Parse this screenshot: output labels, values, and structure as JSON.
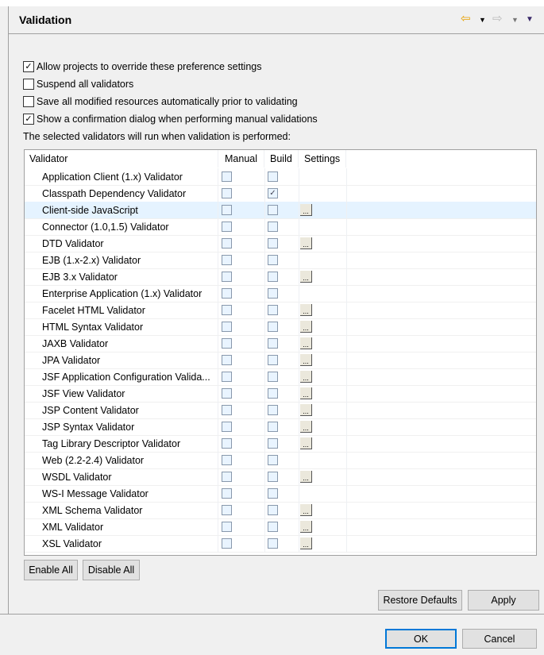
{
  "header": {
    "title": "Validation",
    "icons": [
      "back-arrow-icon",
      "back-menu-icon",
      "forward-arrow-icon",
      "forward-menu-icon",
      "view-menu-icon"
    ]
  },
  "options": [
    {
      "label": "Allow projects to override these preference settings",
      "checked": true
    },
    {
      "label": "Suspend all validators",
      "checked": false
    },
    {
      "label": "Save all modified resources automatically prior to validating",
      "checked": false
    },
    {
      "label": "Show a confirmation dialog when performing manual validations",
      "checked": true
    }
  ],
  "table_caption": "The selected validators will run when validation is performed:",
  "table": {
    "columns": [
      "Validator",
      "Manual",
      "Build",
      "Settings"
    ],
    "selected_row": "Client-side JavaScript",
    "rows": [
      {
        "name": "Application Client (1.x) Validator",
        "manual": false,
        "build": false,
        "settings": false
      },
      {
        "name": "Classpath Dependency Validator",
        "manual": false,
        "build": true,
        "settings": false
      },
      {
        "name": "Client-side JavaScript",
        "manual": false,
        "build": false,
        "settings": true
      },
      {
        "name": "Connector (1.0,1.5) Validator",
        "manual": false,
        "build": false,
        "settings": false
      },
      {
        "name": "DTD Validator",
        "manual": false,
        "build": false,
        "settings": true
      },
      {
        "name": "EJB (1.x-2.x) Validator",
        "manual": false,
        "build": false,
        "settings": false
      },
      {
        "name": "EJB 3.x Validator",
        "manual": false,
        "build": false,
        "settings": true
      },
      {
        "name": "Enterprise Application (1.x) Validator",
        "manual": false,
        "build": false,
        "settings": false
      },
      {
        "name": "Facelet HTML Validator",
        "manual": false,
        "build": false,
        "settings": true
      },
      {
        "name": "HTML Syntax Validator",
        "manual": false,
        "build": false,
        "settings": true
      },
      {
        "name": "JAXB Validator",
        "manual": false,
        "build": false,
        "settings": true
      },
      {
        "name": "JPA Validator",
        "manual": false,
        "build": false,
        "settings": true
      },
      {
        "name": "JSF Application Configuration Valida...",
        "manual": false,
        "build": false,
        "settings": true
      },
      {
        "name": "JSF View Validator",
        "manual": false,
        "build": false,
        "settings": true
      },
      {
        "name": "JSP Content Validator",
        "manual": false,
        "build": false,
        "settings": true
      },
      {
        "name": "JSP Syntax Validator",
        "manual": false,
        "build": false,
        "settings": true
      },
      {
        "name": "Tag Library Descriptor Validator",
        "manual": false,
        "build": false,
        "settings": true
      },
      {
        "name": "Web (2.2-2.4) Validator",
        "manual": false,
        "build": false,
        "settings": false
      },
      {
        "name": "WSDL Validator",
        "manual": false,
        "build": false,
        "settings": true
      },
      {
        "name": "WS-I Message Validator",
        "manual": false,
        "build": false,
        "settings": false
      },
      {
        "name": "XML Schema Validator",
        "manual": false,
        "build": false,
        "settings": true
      },
      {
        "name": "XML Validator",
        "manual": false,
        "build": false,
        "settings": true
      },
      {
        "name": "XSL Validator",
        "manual": false,
        "build": false,
        "settings": true
      }
    ],
    "settings_button_label": "..."
  },
  "buttons": {
    "enable_all": "Enable All",
    "disable_all": "Disable All",
    "restore_defaults": "Restore Defaults",
    "apply": "Apply",
    "ok": "OK",
    "cancel": "Cancel"
  },
  "colors": {
    "selection": "#e5f3ff",
    "ok_border": "#0078d7",
    "back_arrow": "#e8a000"
  }
}
